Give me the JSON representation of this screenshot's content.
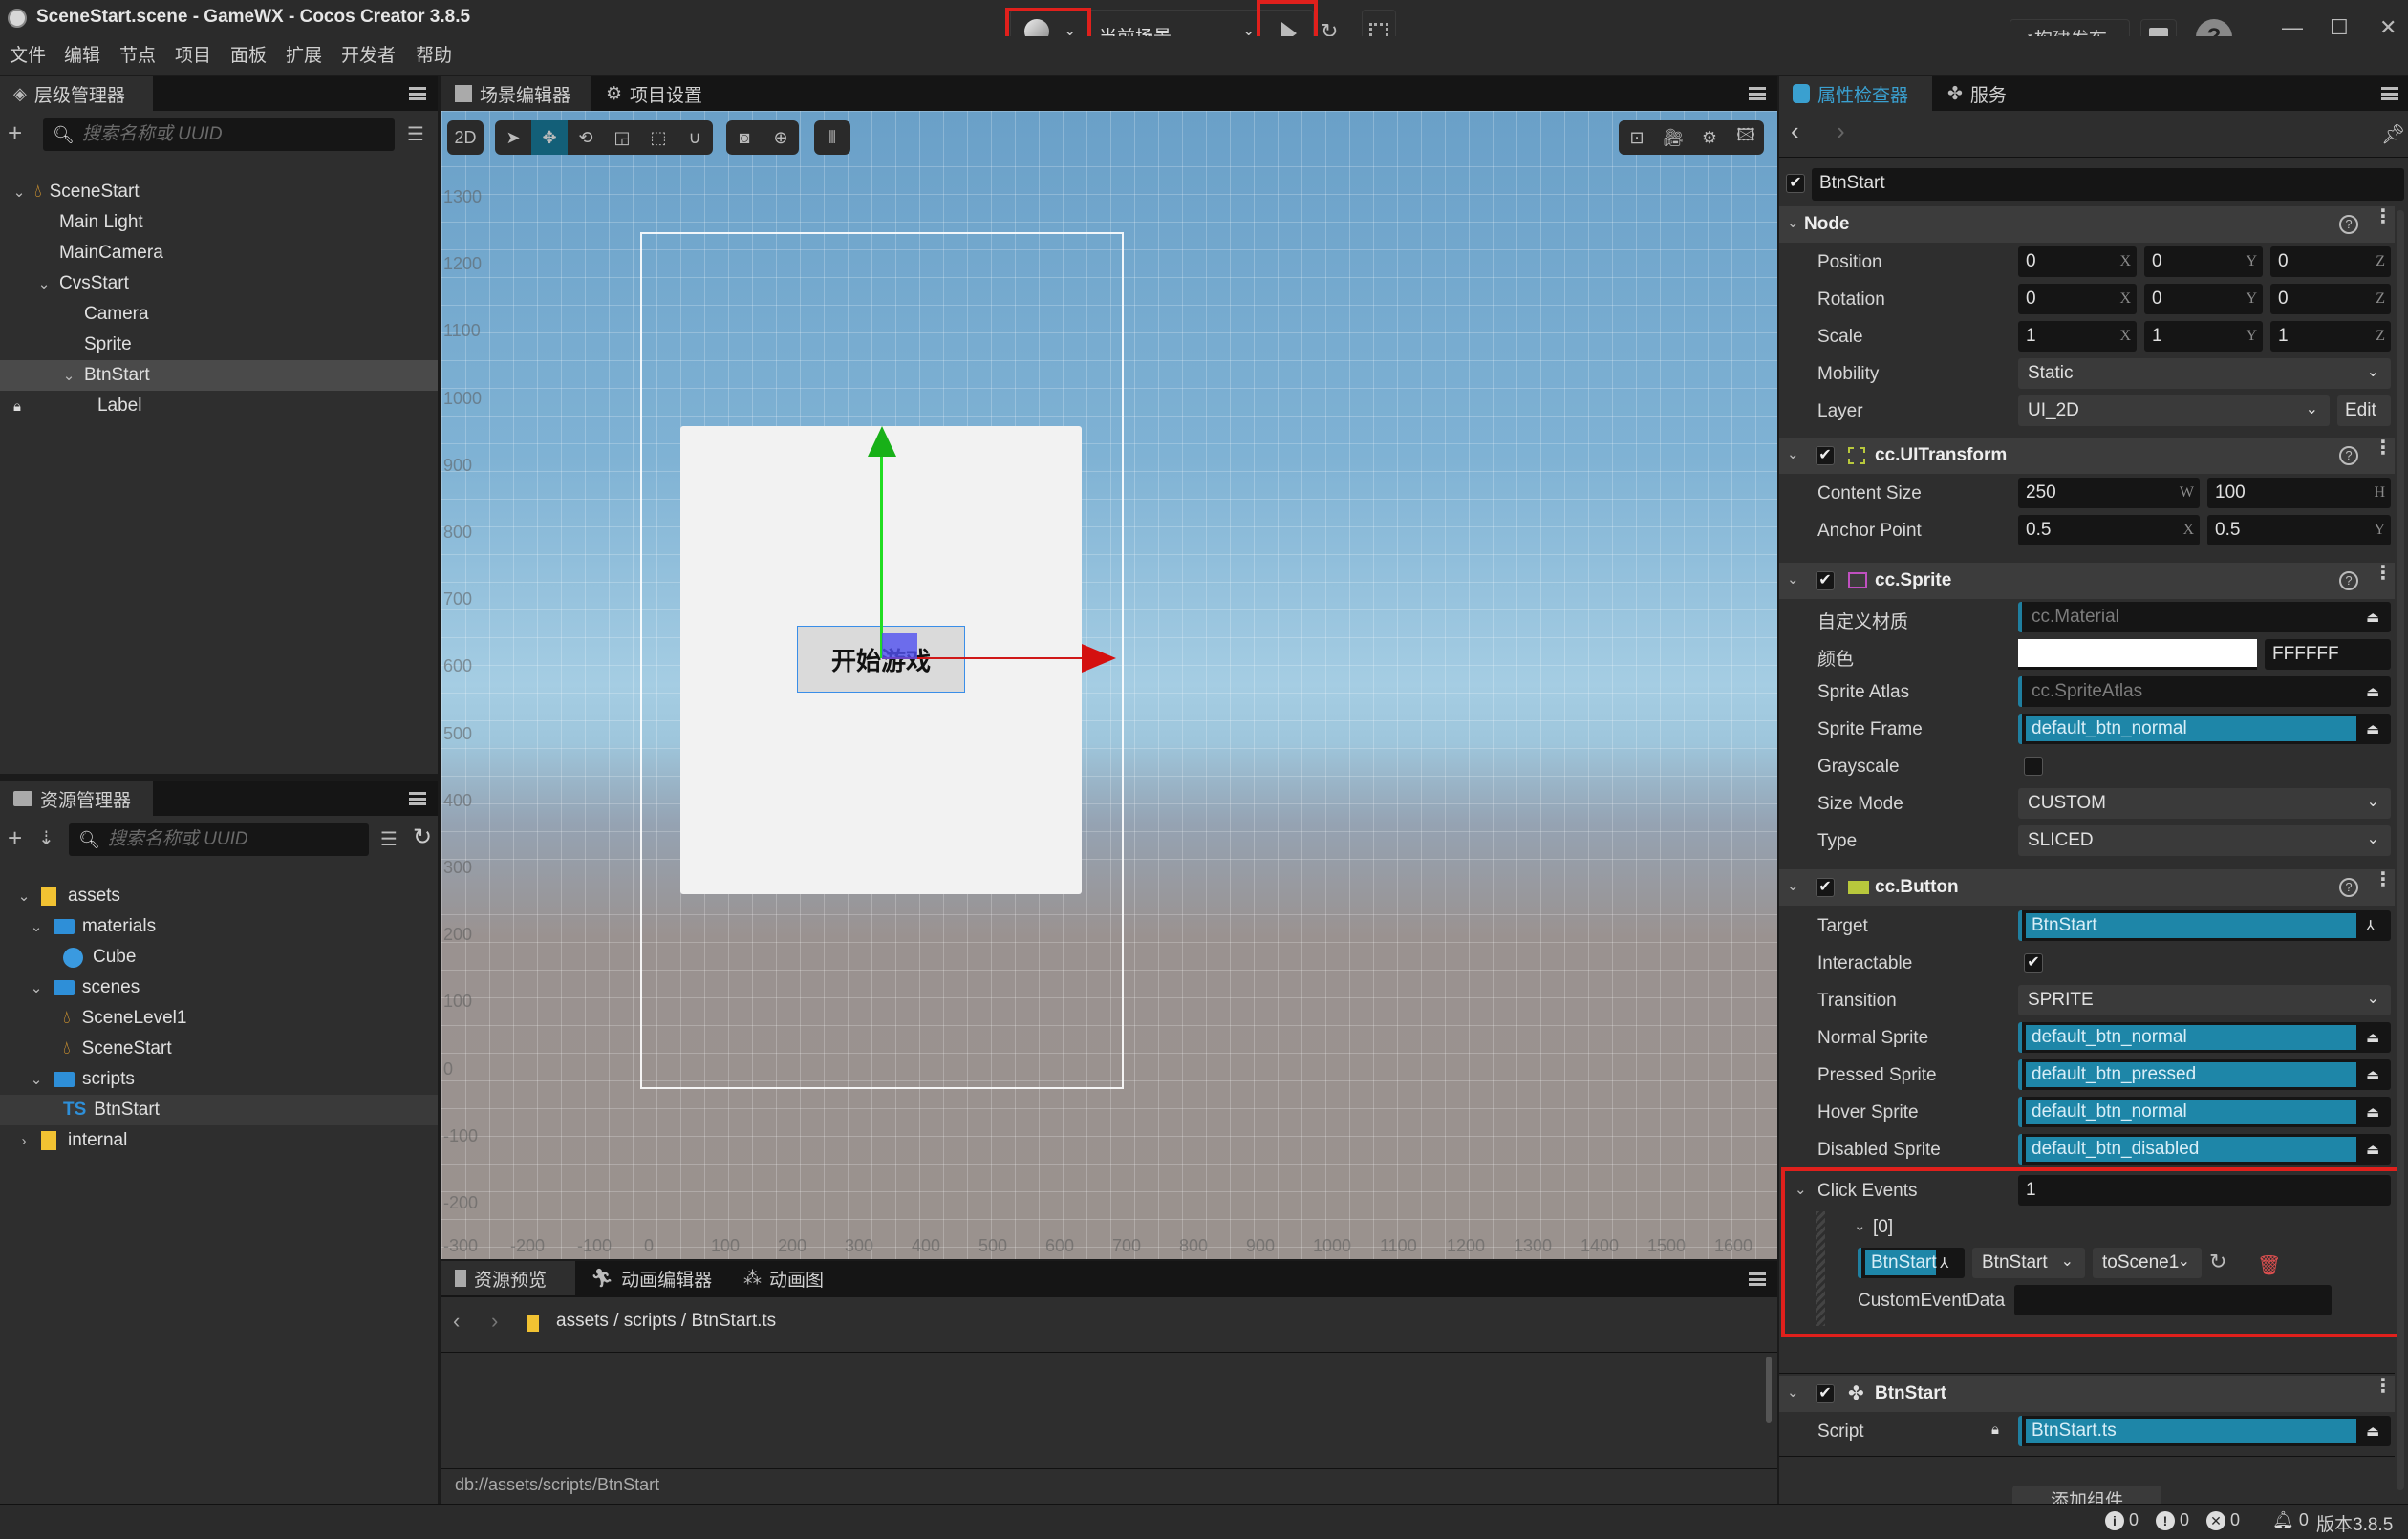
{
  "window": {
    "title": "SceneStart.scene - GameWX - Cocos Creator 3.8.5",
    "controls": {
      "minimize": "—",
      "maximize": "☐",
      "close": "✕"
    }
  },
  "menu": [
    "文件",
    "编辑",
    "节点",
    "项目",
    "面板",
    "扩展",
    "开发者",
    "帮助"
  ],
  "toolbar": {
    "platform_icon": "planet-icon",
    "scene_select": "当前场景",
    "play_icon": "play-icon",
    "refresh_icon": "refresh-icon",
    "qrcode_icon": "qrcode-icon",
    "build_label": "构建发布",
    "open_folder_icon": "folder-icon",
    "help_label": "?",
    "highlight_color": "#e0201c"
  },
  "hierarchy": {
    "tab_label": "层级管理器",
    "search_placeholder": "搜索名称或 UUID",
    "nodes": [
      {
        "label": "SceneStart",
        "depth": 0,
        "expanded": true,
        "icon": "scene-icon"
      },
      {
        "label": "Main Light",
        "depth": 1
      },
      {
        "label": "MainCamera",
        "depth": 1
      },
      {
        "label": "CvsStart",
        "depth": 1,
        "expanded": true
      },
      {
        "label": "Camera",
        "depth": 2
      },
      {
        "label": "Sprite",
        "depth": 2
      },
      {
        "label": "BtnStart",
        "depth": 2,
        "expanded": true,
        "selected": true
      },
      {
        "label": "Label",
        "depth": 3,
        "locked": true
      }
    ]
  },
  "assets": {
    "tab_label": "资源管理器",
    "search_placeholder": "搜索名称或 UUID",
    "items": [
      {
        "label": "assets",
        "depth": 0,
        "expanded": true,
        "icon": "database-icon"
      },
      {
        "label": "materials",
        "depth": 1,
        "expanded": true,
        "icon": "folder-icon"
      },
      {
        "label": "Cube",
        "depth": 2,
        "icon": "material-icon"
      },
      {
        "label": "scenes",
        "depth": 1,
        "expanded": true,
        "icon": "folder-icon"
      },
      {
        "label": "SceneLevel1",
        "depth": 2,
        "icon": "scene-icon"
      },
      {
        "label": "SceneStart",
        "depth": 2,
        "icon": "scene-icon"
      },
      {
        "label": "scripts",
        "depth": 1,
        "expanded": true,
        "icon": "folder-icon"
      },
      {
        "label": "BtnStart",
        "depth": 2,
        "icon": "typescript-icon",
        "selected": true
      },
      {
        "label": "internal",
        "depth": 0,
        "expanded": false,
        "icon": "database-icon"
      }
    ]
  },
  "scene_editor": {
    "tabs": [
      "场景编辑器",
      "项目设置"
    ],
    "mode_2d": "2D",
    "y_axis_labels": [
      "1300",
      "1200",
      "1100",
      "1000",
      "900",
      "800",
      "700",
      "600",
      "500",
      "400",
      "300",
      "200",
      "100",
      "0",
      "-100",
      "-200"
    ],
    "x_axis_labels": [
      "-300",
      "-200",
      "-100",
      "0",
      "100",
      "200",
      "300",
      "400",
      "500",
      "600",
      "700",
      "800",
      "900",
      "1000",
      "1100",
      "1200",
      "1300",
      "1400",
      "1500",
      "1600"
    ],
    "button_text": "开始游戏"
  },
  "bottom_panel": {
    "tabs": [
      "资源预览",
      "动画编辑器",
      "动画图"
    ],
    "breadcrumb": "assets / scripts / BtnStart.ts",
    "db_path": "db://assets/scripts/BtnStart"
  },
  "inspector": {
    "tabs": [
      "属性检查器",
      "服务"
    ],
    "node_name": "BtnStart",
    "node_section": {
      "title": "Node",
      "position": [
        "0",
        "0",
        "0"
      ],
      "rotation": [
        "0",
        "0",
        "0"
      ],
      "scale": [
        "1",
        "1",
        "1"
      ],
      "mobility": "Static",
      "layer": "UI_2D",
      "labels": {
        "position": "Position",
        "rotation": "Rotation",
        "scale": "Scale",
        "mobility": "Mobility",
        "layer": "Layer",
        "edit": "Edit"
      }
    },
    "uitransform": {
      "title": "cc.UITransform",
      "content_size_label": "Content Size",
      "content_size": [
        "250",
        "100"
      ],
      "anchor_label": "Anchor Point",
      "anchor": [
        "0.5",
        "0.5"
      ]
    },
    "sprite": {
      "title": "cc.Sprite",
      "material_label": "自定义材质",
      "material": "cc.Material",
      "color_label": "颜色",
      "color_hex": "FFFFFF",
      "atlas_label": "Sprite Atlas",
      "atlas": "cc.SpriteAtlas",
      "frame_label": "Sprite Frame",
      "frame": "default_btn_normal",
      "grayscale_label": "Grayscale",
      "grayscale": false,
      "size_mode_label": "Size Mode",
      "size_mode": "CUSTOM",
      "type_label": "Type",
      "type": "SLICED"
    },
    "button": {
      "title": "cc.Button",
      "target_label": "Target",
      "target": "BtnStart",
      "interactable_label": "Interactable",
      "interactable": true,
      "transition_label": "Transition",
      "transition": "SPRITE",
      "normal_label": "Normal Sprite",
      "normal": "default_btn_normal",
      "pressed_label": "Pressed Sprite",
      "pressed": "default_btn_pressed",
      "hover_label": "Hover Sprite",
      "hover": "default_btn_normal",
      "disabled_label": "Disabled Sprite",
      "disabled": "default_btn_disabled",
      "click_events_label": "Click Events",
      "click_events_count": "1",
      "event_index": "[0]",
      "event_target": "BtnStart",
      "event_component": "BtnStart",
      "event_handler": "toScene1",
      "custom_data_label": "CustomEventData",
      "custom_data": ""
    },
    "script_component": {
      "title": "BtnStart",
      "script_label": "Script",
      "script": "BtnStart.ts"
    },
    "add_component": "添加组件"
  },
  "statusbar": {
    "info": "0",
    "warn": "0",
    "error": "0",
    "notify": "0",
    "version": "版本3.8.5"
  },
  "colors": {
    "accent": "#1e86a8",
    "inspector_tab": "#3aa0d0",
    "red_highlight": "#e0201c"
  }
}
